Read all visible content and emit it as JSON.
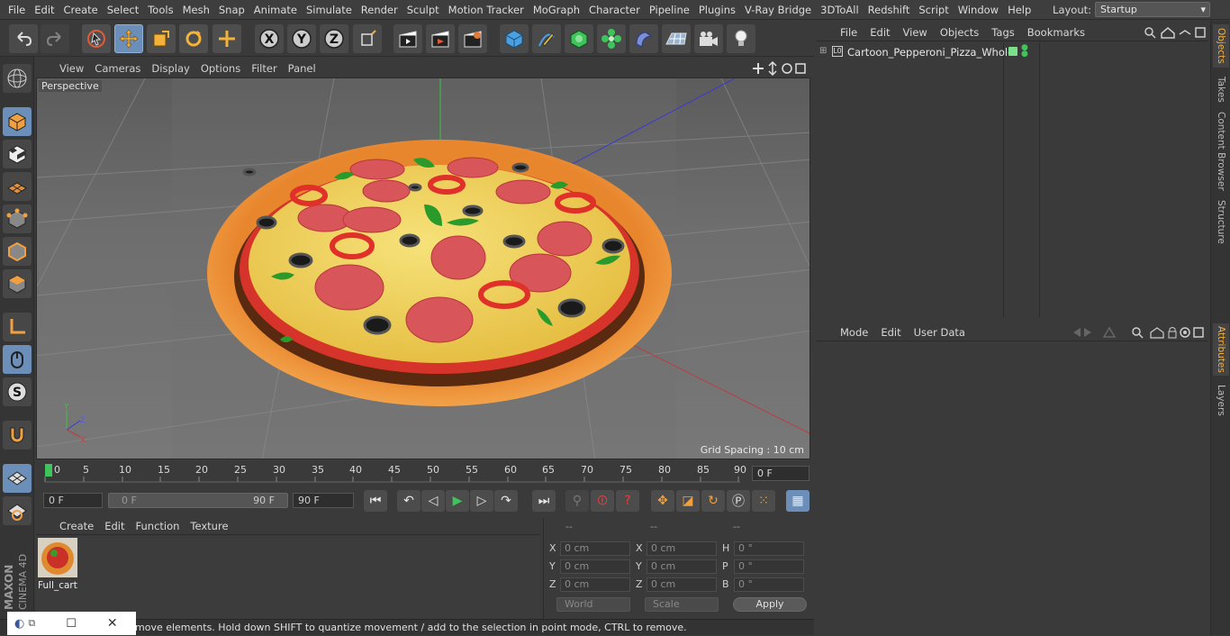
{
  "menubar": {
    "items": [
      "File",
      "Edit",
      "Create",
      "Select",
      "Tools",
      "Mesh",
      "Snap",
      "Animate",
      "Simulate",
      "Render",
      "Sculpt",
      "Motion Tracker",
      "MoGraph",
      "Character",
      "Pipeline",
      "Plugins",
      "V-Ray Bridge",
      "3DToAll",
      "Redshift",
      "Script",
      "Window",
      "Help"
    ],
    "layout_label": "Layout:",
    "layout_value": "Startup"
  },
  "viewport": {
    "menu": [
      "View",
      "Cameras",
      "Display",
      "Options",
      "Filter",
      "Panel"
    ],
    "camera_label": "Perspective",
    "grid_spacing": "Grid Spacing : 10 cm"
  },
  "timeline": {
    "ticks": [
      "0",
      "5",
      "10",
      "15",
      "20",
      "25",
      "30",
      "35",
      "40",
      "45",
      "50",
      "55",
      "60",
      "65",
      "70",
      "75",
      "80",
      "85",
      "90"
    ],
    "current_frame": "0 F"
  },
  "transport": {
    "start_field": "0 F",
    "range_start": "0 F",
    "range_end": "90 F",
    "end_field": "90 F"
  },
  "material_manager": {
    "menu": [
      "Create",
      "Edit",
      "Function",
      "Texture"
    ],
    "material_name": "Full_cart"
  },
  "coordinates": {
    "headers": [
      "--",
      "--",
      "--"
    ],
    "rows": [
      {
        "l1": "X",
        "v1": "0 cm",
        "l2": "X",
        "v2": "0 cm",
        "l3": "H",
        "v3": "0 °"
      },
      {
        "l1": "Y",
        "v1": "0 cm",
        "l2": "Y",
        "v2": "0 cm",
        "l3": "P",
        "v3": "0 °"
      },
      {
        "l1": "Z",
        "v1": "0 cm",
        "l2": "Z",
        "v2": "0 cm",
        "l3": "B",
        "v3": "0 °"
      }
    ],
    "world": "World",
    "scale": "Scale",
    "apply": "Apply"
  },
  "status_text": "move elements. Hold down SHIFT to quantize movement / add to the selection in point mode, CTRL to remove.",
  "object_manager": {
    "menu": [
      "File",
      "Edit",
      "View",
      "Objects",
      "Tags",
      "Bookmarks"
    ],
    "object_name": "Cartoon_Pepperoni_Pizza_Whole"
  },
  "attributes": {
    "menu": [
      "Mode",
      "Edit",
      "User Data"
    ]
  },
  "right_tabs": [
    "Objects",
    "Takes",
    "Content Browser",
    "Structure",
    "Attributes",
    "Layers"
  ],
  "brand": {
    "maxon": "MAXON",
    "product": "CINEMA 4D"
  },
  "colors": {
    "accent": "#6b8fb8",
    "active_tab": "#f0b04a",
    "play": "#3ec45a"
  }
}
